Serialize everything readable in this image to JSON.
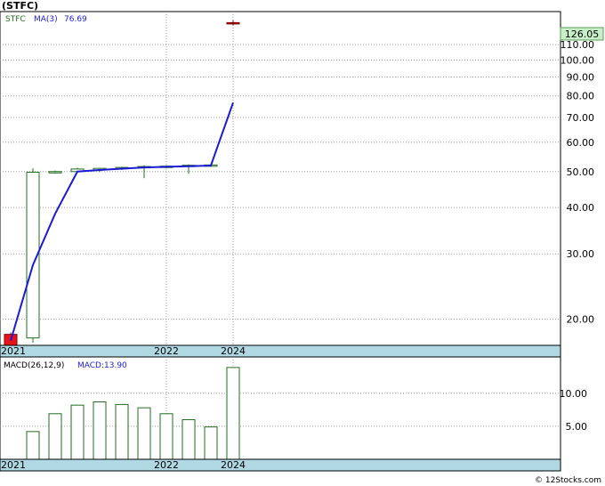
{
  "title": "(STFC)",
  "footer": "© 12Stocks.com",
  "chart_data": [
    {
      "type": "candlestick",
      "symbol": "STFC",
      "indicator_label": "MA(3)",
      "indicator_value": "76.69",
      "last_price": "126.05",
      "y_scale": "log",
      "ylim": [
        17,
        135
      ],
      "y_ticks": [
        "110.00",
        "100.00",
        "90.00",
        "80.00",
        "70.00",
        "60.00",
        "50.00",
        "40.00",
        "30.00",
        "20.00"
      ],
      "x_ticks": [
        "2021",
        "2022",
        "2024"
      ],
      "grid": true,
      "candles": [
        {
          "open": 18.2,
          "high": 18.4,
          "low": 17.3,
          "close": 17.0,
          "color": "#e8141b"
        },
        {
          "open": 17.8,
          "high": 51.0,
          "low": 17.3,
          "close": 49.8,
          "color": "#ffffff"
        },
        {
          "open": 49.6,
          "high": 50.3,
          "low": 49.3,
          "close": 50.0,
          "color": "#ffffff"
        },
        {
          "open": 50.0,
          "high": 51.2,
          "low": 49.6,
          "close": 50.8,
          "color": "#ffffff"
        },
        {
          "open": 50.5,
          "high": 51.2,
          "low": 49.9,
          "close": 51.0,
          "color": "#ffffff"
        },
        {
          "open": 51.0,
          "high": 51.5,
          "low": 50.5,
          "close": 51.3,
          "color": "#ffffff"
        },
        {
          "open": 51.2,
          "high": 52.0,
          "low": 48.0,
          "close": 51.6,
          "color": "#ffffff"
        },
        {
          "open": 51.5,
          "high": 52.0,
          "low": 51.0,
          "close": 51.7,
          "color": "#ffffff"
        },
        {
          "open": 51.7,
          "high": 52.3,
          "low": 49.3,
          "close": 52.0,
          "color": "#ffffff"
        },
        {
          "open": 51.9,
          "high": 52.4,
          "low": 51.5,
          "close": 52.1,
          "color": "#ffffff"
        },
        {
          "open": 125.5,
          "high": 128.0,
          "low": 124.0,
          "close": 126.05,
          "color": "#8b0000"
        }
      ],
      "ma_values": [
        17.5,
        28.0,
        38.5,
        50.0,
        50.5,
        50.9,
        51.3,
        51.5,
        51.7,
        51.9,
        76.69
      ]
    },
    {
      "type": "bar",
      "indicator_label": "MACD(26,12,9)",
      "macd_label": "MACD:13.90",
      "ylim": [
        0,
        15.5
      ],
      "y_ticks": [
        "10.00",
        "5.00"
      ],
      "x_ticks": [
        "2021",
        "2022",
        "2024"
      ],
      "values": [
        4.2,
        6.9,
        8.2,
        8.7,
        8.3,
        7.8,
        6.9,
        6.0,
        4.9,
        13.9
      ]
    }
  ]
}
